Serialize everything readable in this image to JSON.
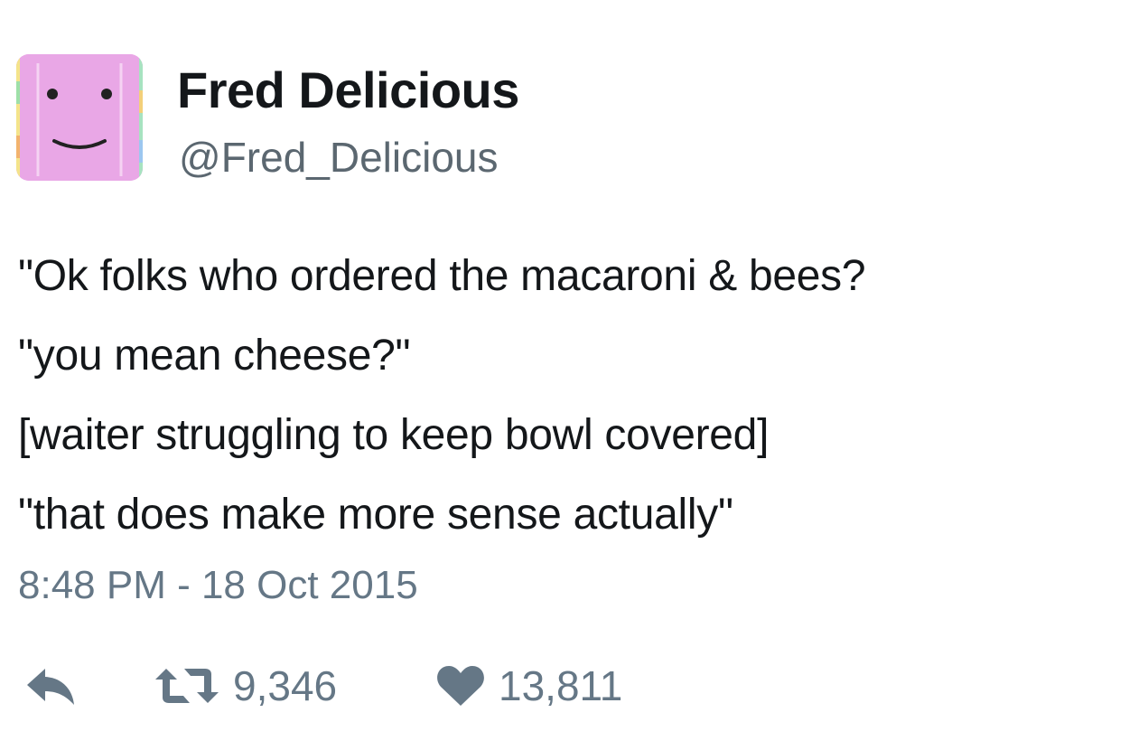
{
  "author": {
    "display_name": "Fred Delicious",
    "handle": "@Fred_Delicious",
    "avatar": "smiley-face-avatar"
  },
  "tweet": {
    "lines": [
      "\"Ok folks who ordered the macaroni & bees?",
      "\"you mean cheese?\"",
      "[waiter struggling to keep bowl covered]",
      "\"that does make more sense actually\""
    ],
    "timestamp": "8:48 PM - 18 Oct 2015"
  },
  "actions": {
    "reply_icon": "reply-arrow-icon",
    "retweet_icon": "retweet-icon",
    "retweet_count": "9,346",
    "like_icon": "heart-icon",
    "like_count": "13,811"
  },
  "colors": {
    "avatar_pink": "#e9a7e6",
    "muted_gray": "#657786",
    "text": "#14171a"
  }
}
